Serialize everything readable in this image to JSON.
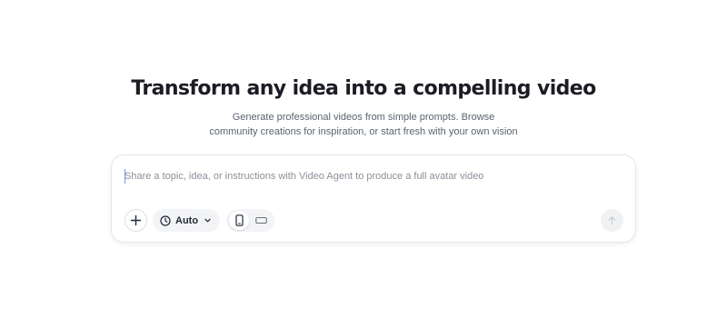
{
  "hero": {
    "title": "Transform any idea into a compelling video",
    "subtitle": "Generate professional videos from simple prompts. Browse community creations for inspiration, or start fresh with your own vision"
  },
  "composer": {
    "placeholder": "Share a topic, idea, or instructions with Video Agent to produce a full avatar video",
    "value": "",
    "duration": {
      "selected": "Auto",
      "icon": "clock-icon"
    },
    "aspect_ratio": {
      "options": [
        {
          "id": "portrait",
          "icon": "phone-portrait-icon",
          "selected": true
        },
        {
          "id": "landscape",
          "icon": "landscape-rectangle-icon",
          "selected": false
        }
      ]
    },
    "add_icon": "plus-icon",
    "send_icon": "arrow-up-icon",
    "send_enabled": false
  },
  "colors": {
    "title": "#1c1d24",
    "subtitle": "#5b6270",
    "placeholder": "#8a9099",
    "caret": "#7c8cff",
    "pill_background": "#f3f4f6",
    "send_disabled": "#f0f1f3"
  }
}
